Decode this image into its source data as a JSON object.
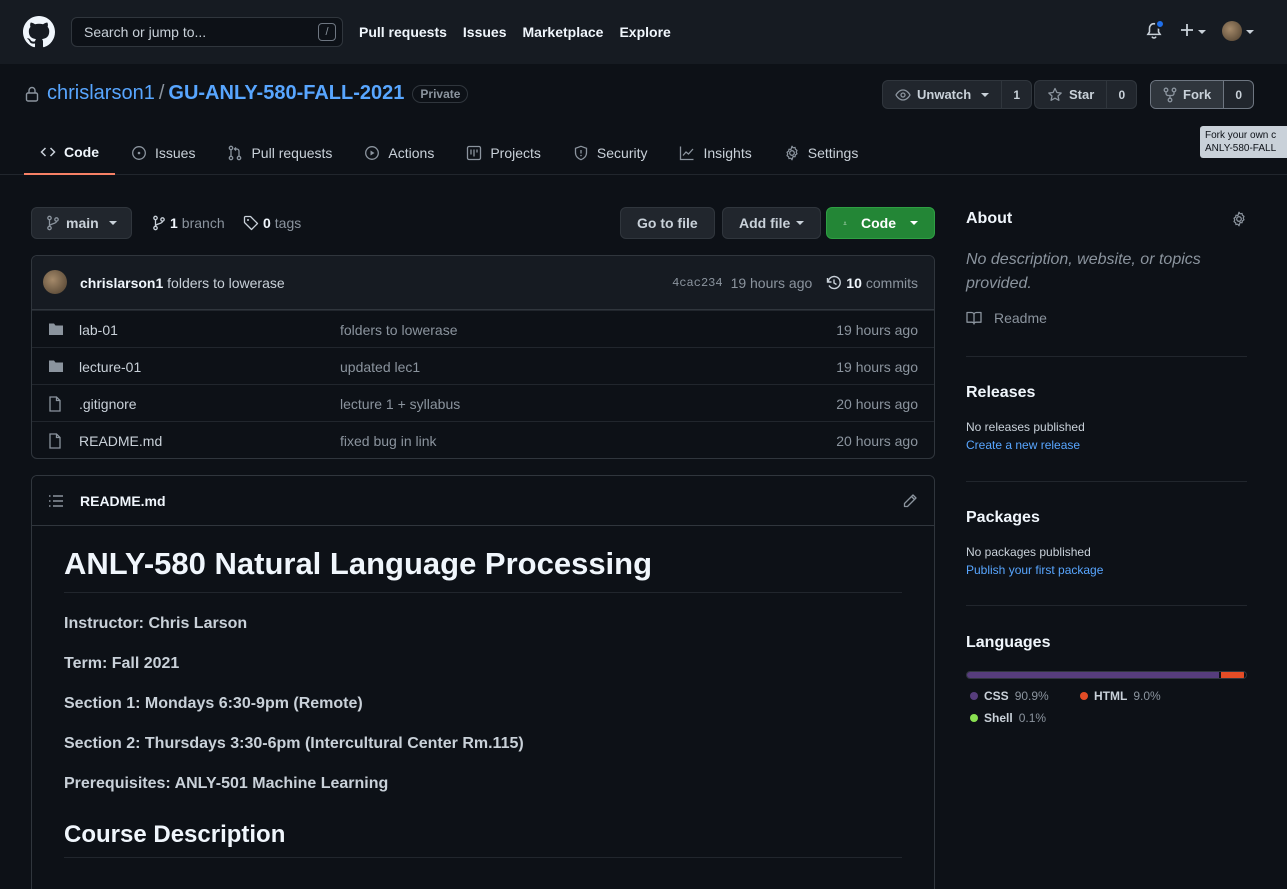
{
  "topnav": {
    "search_placeholder": "Search or jump to...",
    "search_shortcut": "/",
    "links": [
      "Pull requests",
      "Issues",
      "Marketplace",
      "Explore"
    ]
  },
  "repo": {
    "owner": "chrislarson1",
    "separator": "/",
    "name": "GU-ANLY-580-FALL-2021",
    "visibility": "Private",
    "unwatch_label": "Unwatch",
    "unwatch_count": "1",
    "star_label": "Star",
    "star_count": "0",
    "fork_label": "Fork",
    "fork_count": "0",
    "fork_tooltip_line1": "Fork your own c",
    "fork_tooltip_line2": "ANLY-580-FALL"
  },
  "tabs": [
    {
      "label": "Code",
      "icon": "code-icon"
    },
    {
      "label": "Issues",
      "icon": "issue-icon"
    },
    {
      "label": "Pull requests",
      "icon": "pull-request-icon"
    },
    {
      "label": "Actions",
      "icon": "play-icon"
    },
    {
      "label": "Projects",
      "icon": "project-icon"
    },
    {
      "label": "Security",
      "icon": "shield-icon"
    },
    {
      "label": "Insights",
      "icon": "graph-icon"
    },
    {
      "label": "Settings",
      "icon": "gear-icon"
    }
  ],
  "branchbar": {
    "branch": "main",
    "branch_count": "1",
    "branch_label": "branch",
    "tag_count": "0",
    "tag_label": "tags",
    "goto_file": "Go to file",
    "add_file": "Add file",
    "code": "Code"
  },
  "commit": {
    "author": "chrislarson1",
    "message": "folders to lowerase",
    "sha": "4cac234",
    "time": "19 hours ago",
    "commit_count": "10",
    "commit_label": "commits"
  },
  "files": [
    {
      "type": "folder",
      "name": "lab-01",
      "message": "folders to lowerase",
      "time": "19 hours ago"
    },
    {
      "type": "folder",
      "name": "lecture-01",
      "message": "updated lec1",
      "time": "19 hours ago"
    },
    {
      "type": "file",
      "name": ".gitignore",
      "message": "lecture 1 + syllabus",
      "time": "20 hours ago"
    },
    {
      "type": "file",
      "name": "README.md",
      "message": "fixed bug in link",
      "time": "20 hours ago"
    }
  ],
  "readme": {
    "filename": "README.md",
    "h1": "ANLY-580 Natural Language Processing",
    "lines": [
      "Instructor: Chris Larson",
      "Term: Fall 2021",
      "Section 1: Mondays 6:30-9pm (Remote)",
      "Section 2: Thursdays 3:30-6pm (Intercultural Center Rm.115)",
      "Prerequisites: ANLY-501 Machine Learning"
    ],
    "h2": "Course Description"
  },
  "about": {
    "title": "About",
    "description": "No description, website, or topics provided.",
    "readme_link": "Readme"
  },
  "releases": {
    "title": "Releases",
    "empty": "No releases published",
    "action": "Create a new release"
  },
  "packages": {
    "title": "Packages",
    "empty": "No packages published",
    "action": "Publish your first package"
  },
  "languages": {
    "title": "Languages",
    "items": [
      {
        "name": "CSS",
        "percent": "90.9%",
        "value": 90.9,
        "color": "#563d7c"
      },
      {
        "name": "HTML",
        "percent": "9.0%",
        "value": 9.0,
        "color": "#e34c26"
      },
      {
        "name": "Shell",
        "percent": "0.1%",
        "value": 0.1,
        "color": "#89e051"
      }
    ]
  }
}
